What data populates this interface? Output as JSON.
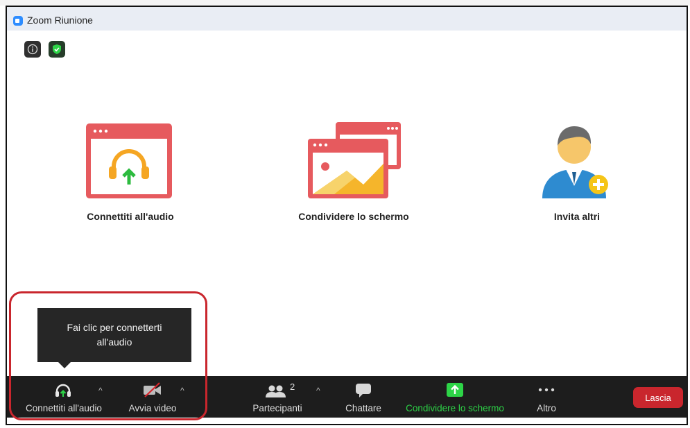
{
  "window": {
    "title": "Zoom Riunione"
  },
  "actions": [
    {
      "label": "Connettiti all'audio",
      "icon": "headphones-audio-icon"
    },
    {
      "label": "Condividere lo schermo",
      "icon": "share-screen-windows-icon"
    },
    {
      "label": "Invita altri",
      "icon": "invite-person-icon"
    }
  ],
  "tooltip": {
    "text": "Fai clic per connetterti all'audio"
  },
  "toolbar": {
    "audio_label": "Connettiti all'audio",
    "video_label": "Avvia video",
    "participants_label": "Partecipanti",
    "participants_count": "2",
    "chat_label": "Chattare",
    "share_label": "Condividere lo schermo",
    "more_label": "Altro",
    "leave_label": "Lascia"
  },
  "colors": {
    "share_green": "#2dd447",
    "leave_red": "#c9262d",
    "card_red": "#e65a5e",
    "headphone_orange": "#f5a623",
    "highlight_red": "#c9262d"
  }
}
